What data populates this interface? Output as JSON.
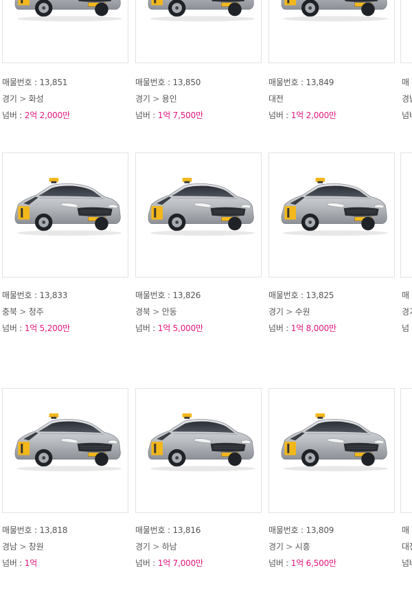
{
  "label_no": "매물번호",
  "label_price": "넘버",
  "colon": " : ",
  "arrow": " > ",
  "colors": {
    "price": "#e0157a",
    "text": "#555555",
    "border": "#e3e3e3"
  },
  "listings": [
    {
      "no": "13,851",
      "region": "경기",
      "city": "화성",
      "price": "2억 2,000만"
    },
    {
      "no": "13,850",
      "region": "경기",
      "city": "용인",
      "price": "1억 7,500만"
    },
    {
      "no": "13,849",
      "region": "대전",
      "city": "",
      "price": "1억 2,000만"
    },
    {
      "no": "13,833",
      "region": "충북",
      "city": "청주",
      "price": "1억 5,200만"
    },
    {
      "no": "13,826",
      "region": "경북",
      "city": "안동",
      "price": "1억 5,000만"
    },
    {
      "no": "13,825",
      "region": "경기",
      "city": "수원",
      "price": "1억 8,000만"
    },
    {
      "no": "13,818",
      "region": "경남",
      "city": "창원",
      "price": "1억"
    },
    {
      "no": "13,816",
      "region": "경기",
      "city": "하남",
      "price": "1억 7,000만"
    },
    {
      "no": "13,809",
      "region": "경기",
      "city": "시흥",
      "price": "1억 6,500만"
    }
  ],
  "partial_column": [
    {
      "no_prefix": "매",
      "region_prefix": "경남",
      "price_prefix": "넘버"
    },
    {
      "no_prefix": "매",
      "region_prefix": "경기",
      "price_prefix": "넘"
    },
    {
      "no_prefix": "매",
      "region_prefix": "대전",
      "price_prefix": "넘버"
    }
  ],
  "car_icon": "taxi-car-image"
}
